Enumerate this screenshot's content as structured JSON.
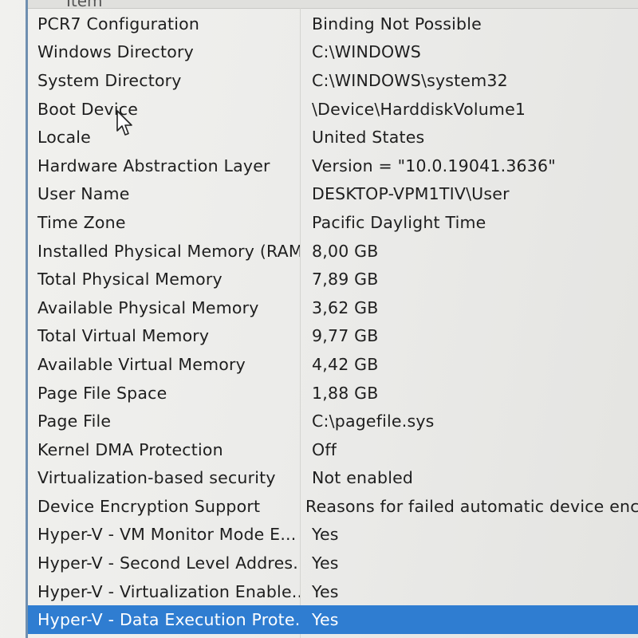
{
  "header": {
    "item_col": "Item"
  },
  "rows": [
    {
      "item": "PCR7 Configuration",
      "value": "Binding Not Possible"
    },
    {
      "item": "Windows Directory",
      "value": "C:\\WINDOWS"
    },
    {
      "item": "System Directory",
      "value": "C:\\WINDOWS\\system32"
    },
    {
      "item": "Boot Device",
      "value": "\\Device\\HarddiskVolume1"
    },
    {
      "item": "Locale",
      "value": "United States"
    },
    {
      "item": "Hardware Abstraction Layer",
      "value": "Version = \"10.0.19041.3636\""
    },
    {
      "item": "User Name",
      "value": "DESKTOP-VPM1TIV\\User"
    },
    {
      "item": "Time Zone",
      "value": "Pacific Daylight Time"
    },
    {
      "item": "Installed Physical Memory (RAM)",
      "value": "8,00 GB"
    },
    {
      "item": "Total Physical Memory",
      "value": "7,89 GB"
    },
    {
      "item": "Available Physical Memory",
      "value": "3,62 GB"
    },
    {
      "item": "Total Virtual Memory",
      "value": "9,77 GB"
    },
    {
      "item": "Available Virtual Memory",
      "value": "4,42 GB"
    },
    {
      "item": "Page File Space",
      "value": "1,88 GB"
    },
    {
      "item": "Page File",
      "value": "C:\\pagefile.sys"
    },
    {
      "item": "Kernel DMA Protection",
      "value": "Off"
    },
    {
      "item": "Virtualization-based security",
      "value": "Not enabled"
    },
    {
      "item": "Device Encryption Support",
      "value": "Reasons for failed automatic device encr"
    },
    {
      "item": "Hyper-V - VM Monitor Mode E...",
      "value": "Yes"
    },
    {
      "item": "Hyper-V - Second Level Addres...",
      "value": "Yes"
    },
    {
      "item": "Hyper-V - Virtualization Enable...",
      "value": "Yes"
    },
    {
      "item": "Hyper-V - Data Execution Prote...",
      "value": "Yes",
      "selected": true
    }
  ],
  "colors": {
    "selection": "#2f7dd1",
    "border": "#6f8fb0"
  },
  "icons": {
    "cursor": "mouse-pointer-icon"
  }
}
